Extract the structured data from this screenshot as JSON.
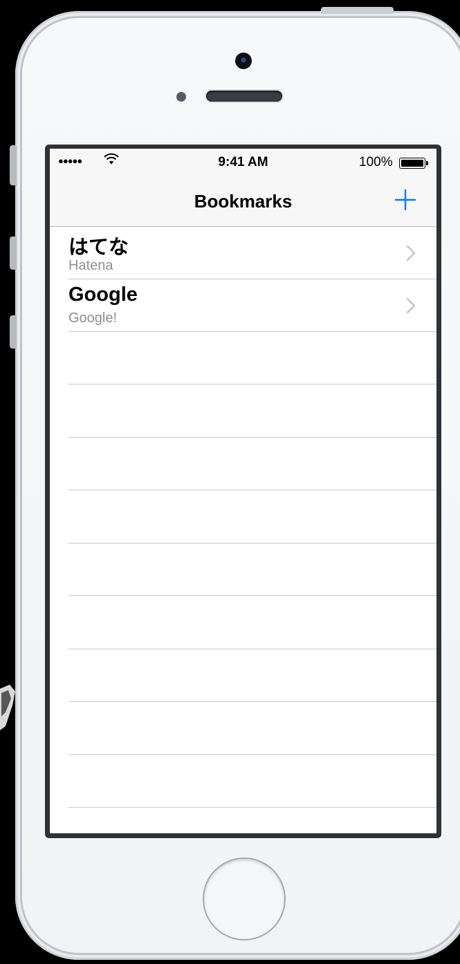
{
  "status_bar": {
    "signal_icon": "signal-dots-icon",
    "wifi_icon": "wifi-icon",
    "time": "9:41 AM",
    "battery_percent": "100%",
    "battery_icon": "battery-icon"
  },
  "nav": {
    "title": "Bookmarks",
    "add_icon": "plus-icon",
    "accent_color": "#007aff"
  },
  "bookmarks": [
    {
      "title": "はてな",
      "subtitle": "Hatena"
    },
    {
      "title": "Google",
      "subtitle": "Google!"
    }
  ],
  "colors": {
    "separator": "#c8c7cc",
    "subtitle": "#8e8e93",
    "chevron": "#c7c7cc"
  }
}
